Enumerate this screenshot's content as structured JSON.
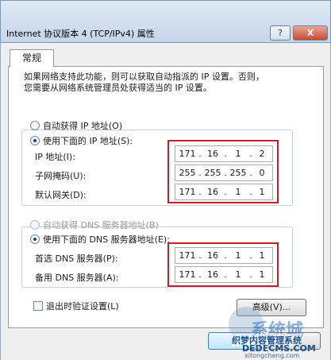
{
  "window": {
    "title": "Internet 协议版本 4 (TCP/IPv4) 属性",
    "help_label": "?",
    "close_label": "X"
  },
  "tab": {
    "label": "常规"
  },
  "description": "如果网络支持此功能，则可以获取自动指派的 IP 设置。否则，\n您需要从网络系统管理员处获得适当的 IP 设置。",
  "ip": {
    "auto_label": "自动获得 IP 地址(O)",
    "manual_label": "使用下面的 IP 地址(S):",
    "selected": "manual",
    "fields": [
      {
        "label": "IP 地址(I):",
        "octets": [
          "171",
          "16",
          "1",
          "2"
        ]
      },
      {
        "label": "子网掩码(U):",
        "octets": [
          "255",
          "255",
          "255",
          "0"
        ]
      },
      {
        "label": "默认网关(D):",
        "octets": [
          "171",
          "16",
          "1",
          "1"
        ]
      }
    ]
  },
  "dns": {
    "auto_label": "自动获得 DNS 服务器地址(B)",
    "manual_label": "使用下面的 DNS 服务器地址(E):",
    "selected": "manual",
    "fields": [
      {
        "label": "首选 DNS 服务器(P):",
        "octets": [
          "171",
          "16",
          "1",
          "1"
        ]
      },
      {
        "label": "备用 DNS 服务器(A):",
        "octets": [
          "171",
          "16",
          "1",
          "1"
        ]
      }
    ]
  },
  "validate_on_exit": {
    "label": "退出时验证设置(L)",
    "checked": false
  },
  "advanced_label": "高级(V)...",
  "watermark": {
    "brand": "系统城",
    "line1": "织梦内容管理系统",
    "line2": "DEDECMS.COM",
    "line3": "xitongcheng.com"
  },
  "colors": {
    "highlight_box": "#c4202a",
    "title_bar": "#c6d7ea"
  }
}
